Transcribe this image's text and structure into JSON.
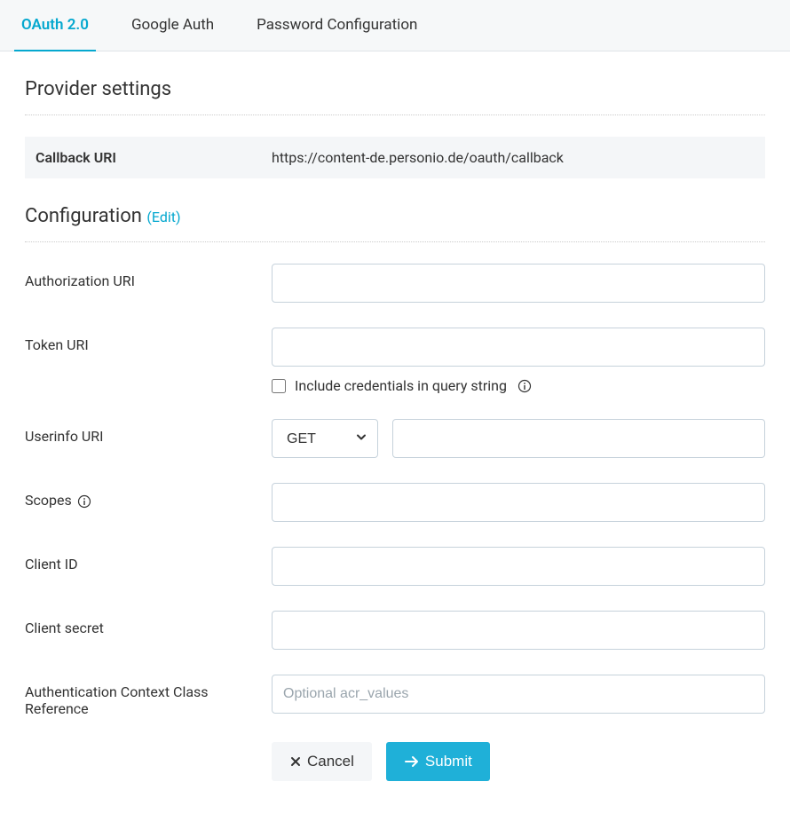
{
  "tabs": {
    "oauth": "OAuth 2.0",
    "google": "Google Auth",
    "password": "Password Configuration"
  },
  "provider": {
    "heading": "Provider settings",
    "callback_label": "Callback URI",
    "callback_value": "https://content-de.personio.de/oauth/callback"
  },
  "config": {
    "heading": "Configuration ",
    "edit": "(Edit)",
    "fields": {
      "authorization_uri": "Authorization URI",
      "token_uri": "Token URI",
      "include_credentials": "Include credentials in query string",
      "userinfo_uri": "Userinfo URI",
      "method_selected": "GET",
      "scopes": "Scopes",
      "client_id": "Client ID",
      "client_secret": "Client secret",
      "acr": "Authentication Context Class Reference",
      "acr_placeholder": "Optional acr_values"
    }
  },
  "buttons": {
    "cancel": "Cancel",
    "submit": "Submit"
  }
}
